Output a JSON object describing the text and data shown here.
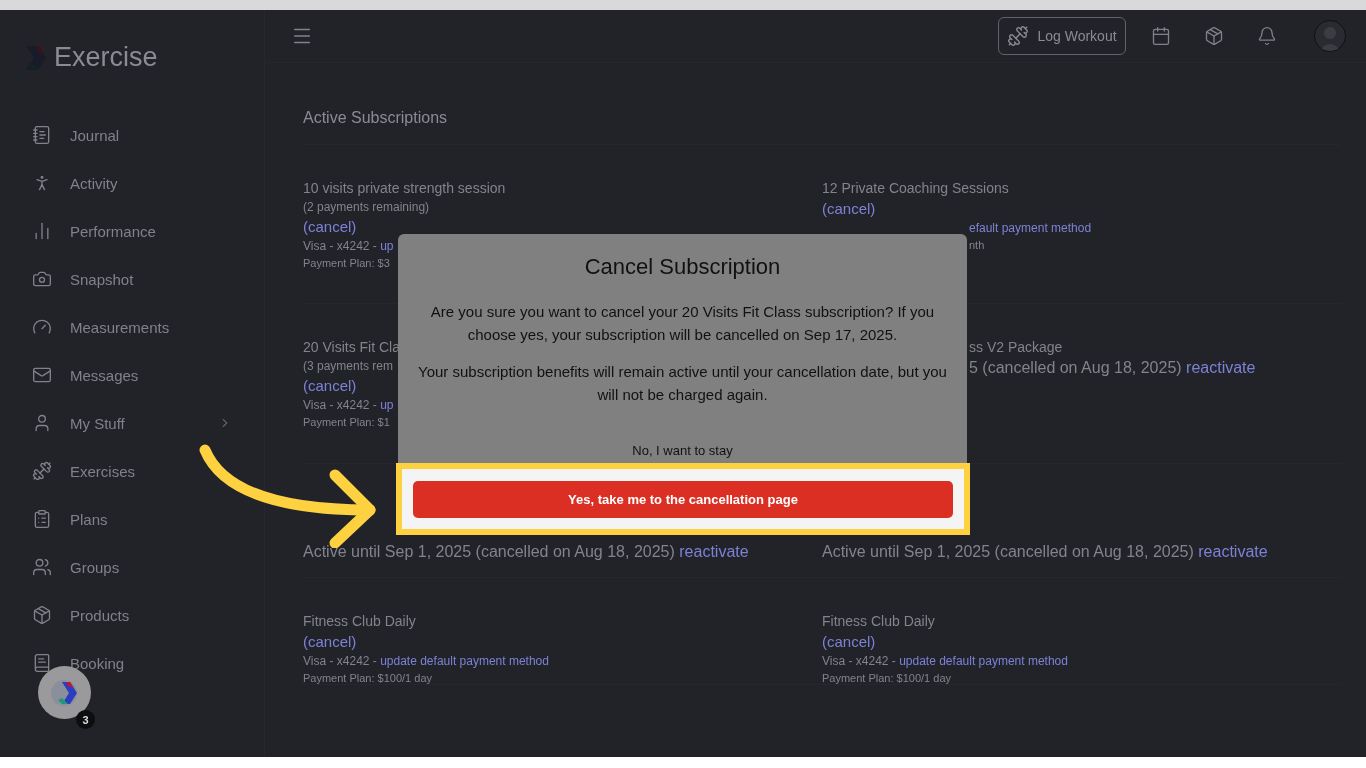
{
  "sidebar": {
    "logo": "Exercise",
    "items": [
      {
        "label": "Journal",
        "expandable": false
      },
      {
        "label": "Activity",
        "expandable": false
      },
      {
        "label": "Performance",
        "expandable": false
      },
      {
        "label": "Snapshot",
        "expandable": false
      },
      {
        "label": "Measurements",
        "expandable": false
      },
      {
        "label": "Messages",
        "expandable": false
      },
      {
        "label": "My Stuff",
        "expandable": true
      },
      {
        "label": "Exercises",
        "expandable": false
      },
      {
        "label": "Plans",
        "expandable": false
      },
      {
        "label": "Groups",
        "expandable": false
      },
      {
        "label": "Products",
        "expandable": false
      },
      {
        "label": "Booking",
        "expandable": false
      }
    ],
    "help_badge": "3"
  },
  "topbar": {
    "log_button": "Log Workout"
  },
  "content": {
    "title": "Active Subscriptions",
    "cards": [
      {
        "heading_hidden": false,
        "lines": [
          {
            "kind": "title",
            "text": "10 visits private strength session",
            "behind_dialog": false
          },
          {
            "kind": "note",
            "text": "(2 payments remaining)",
            "behind_dialog": false
          },
          {
            "kind": "cancel",
            "text": "(cancel)",
            "behind_dialog": false
          },
          {
            "kind": "payment",
            "text": "Visa - x4242 - ",
            "link": "up",
            "behind_dialog": false
          },
          {
            "kind": "plan",
            "text": "Payment Plan: $3",
            "behind_dialog": false
          }
        ]
      },
      {
        "heading_hidden": false,
        "lines": [
          {
            "kind": "title",
            "text": "12 Private Coaching Sessions",
            "behind_dialog": false
          },
          {
            "kind": "cancel",
            "text": "(cancel)",
            "behind_dialog": false
          },
          {
            "kind": "payment",
            "link": "efault payment method",
            "behind_dialog": true
          },
          {
            "kind": "plan",
            "text": "nth",
            "behind_dialog": true
          }
        ]
      },
      {
        "heading_hidden": false,
        "lines": [
          {
            "kind": "title",
            "text": "20 Visits Fit Cla",
            "behind_dialog": false
          },
          {
            "kind": "note",
            "text": "(3 payments rem",
            "behind_dialog": false
          },
          {
            "kind": "cancel",
            "text": "(cancel)",
            "behind_dialog": false
          },
          {
            "kind": "payment",
            "text": "Visa - x4242 - ",
            "link": "up",
            "behind_dialog": false
          },
          {
            "kind": "plan",
            "text": "Payment Plan: $1",
            "behind_dialog": false
          }
        ]
      },
      {
        "heading_hidden": false,
        "lines": [
          {
            "kind": "title",
            "text": "ss V2 Package",
            "behind_dialog": true
          },
          {
            "kind": "status",
            "text": "5 (cancelled on Aug 18, 2025)",
            "link": "reactivate",
            "behind_dialog": true
          }
        ]
      },
      {
        "heading_hidden": true,
        "lines": [
          {
            "kind": "status",
            "text": "Active until Sep 1, 2025 (cancelled on Aug 18, 2025)",
            "link": "reactivate",
            "behind_dialog": false
          }
        ]
      },
      {
        "heading_hidden": true,
        "lines": [
          {
            "kind": "status",
            "text": "Active until Sep 1, 2025 (cancelled on Aug 18, 2025)",
            "link": "reactivate",
            "behind_dialog": false
          }
        ]
      },
      {
        "heading_hidden": false,
        "lines": [
          {
            "kind": "title",
            "text": "Fitness Club Daily",
            "behind_dialog": false
          },
          {
            "kind": "cancel",
            "text": "(cancel)",
            "behind_dialog": false
          },
          {
            "kind": "payment",
            "text": "Visa - x4242 - ",
            "link": "update default payment method",
            "behind_dialog": false
          },
          {
            "kind": "plan",
            "text": "Payment Plan: $100/1 day",
            "behind_dialog": false
          }
        ]
      },
      {
        "heading_hidden": false,
        "lines": [
          {
            "kind": "title",
            "text": "Fitness Club Daily",
            "behind_dialog": false
          },
          {
            "kind": "cancel",
            "text": "(cancel)",
            "behind_dialog": false
          },
          {
            "kind": "payment",
            "text": "Visa - x4242 - ",
            "link": "update default payment method",
            "behind_dialog": false
          },
          {
            "kind": "plan",
            "text": "Payment Plan: $100/1 day",
            "behind_dialog": false
          }
        ]
      }
    ]
  },
  "dialog": {
    "title": "Cancel Subscription",
    "paragraphs": [
      "Are you sure you want to cancel your 20 Visits Fit Class subscription? If you choose yes, your subscription will be cancelled on Sep 17, 2025.",
      "Your subscription benefits will remain active until your cancellation date, but you will not be charged again."
    ],
    "stay_button": "No, I want to stay",
    "confirm_button": "Yes, take me to the cancellation page"
  }
}
